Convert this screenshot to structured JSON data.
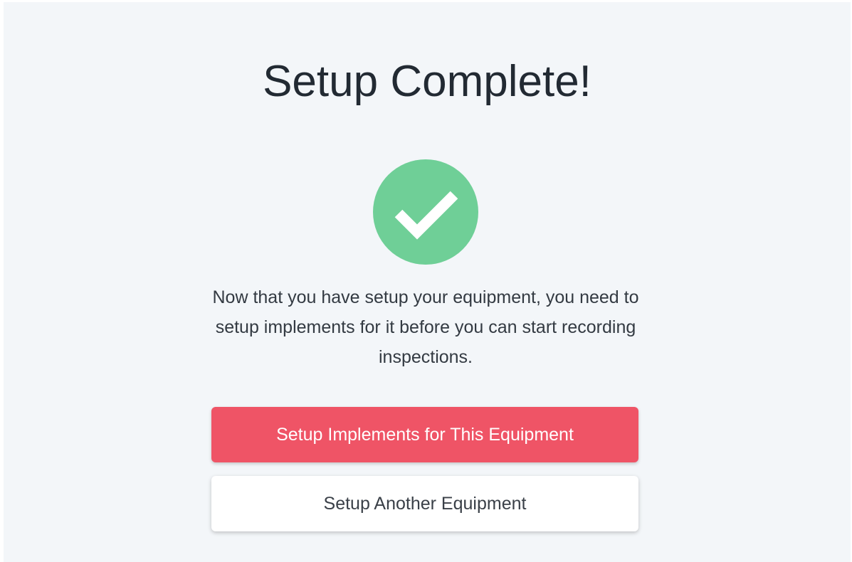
{
  "page": {
    "title": "Setup Complete!",
    "message": "Now that you have setup your equipment, you need to setup implements for it before you can start recording inspections.",
    "icon": "check-circle-icon"
  },
  "actions": {
    "primary_label": "Setup Implements for This Equipment",
    "secondary_label": "Setup Another Equipment"
  },
  "colors": {
    "success": "#6fcf97",
    "primary": "#ef5466",
    "background": "#f3f6f9"
  }
}
